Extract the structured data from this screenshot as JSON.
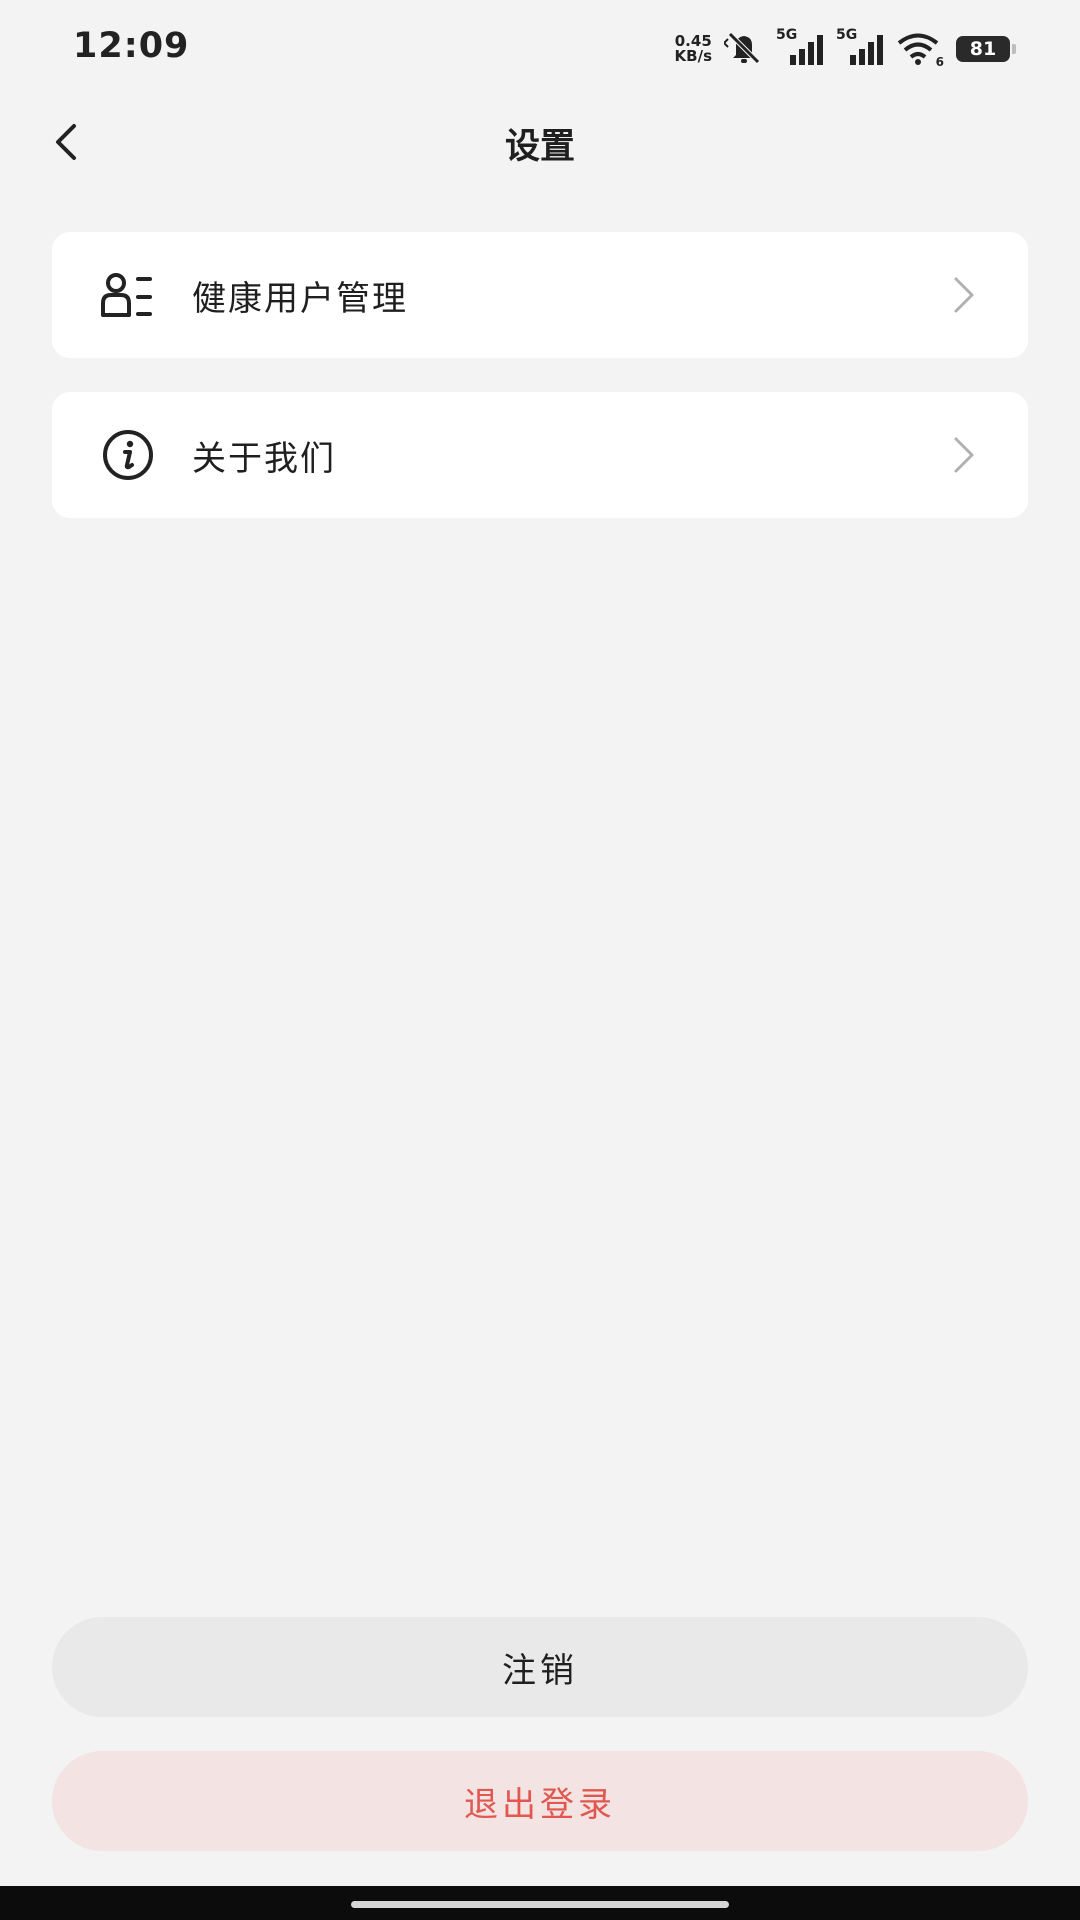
{
  "status_bar": {
    "time": "12:09",
    "speed_value": "0.45",
    "speed_unit": "KB/s",
    "sim1_tag": "5G",
    "sim2_tag": "5G",
    "wifi_tag": "6",
    "battery": "81"
  },
  "header": {
    "title": "设置",
    "back_icon": "chevron-left-icon"
  },
  "menu": {
    "items": [
      {
        "label": "健康用户管理",
        "icon": "user-list-icon"
      },
      {
        "label": "关于我们",
        "icon": "info-icon"
      }
    ]
  },
  "buttons": {
    "deregister_label": "注销",
    "logout_label": "退出登录"
  },
  "colors": {
    "background": "#f3f3f3",
    "card": "#ffffff",
    "deregister_bg": "#e9e9e9",
    "logout_bg": "#f3e3e3",
    "logout_text": "#e0584f"
  }
}
